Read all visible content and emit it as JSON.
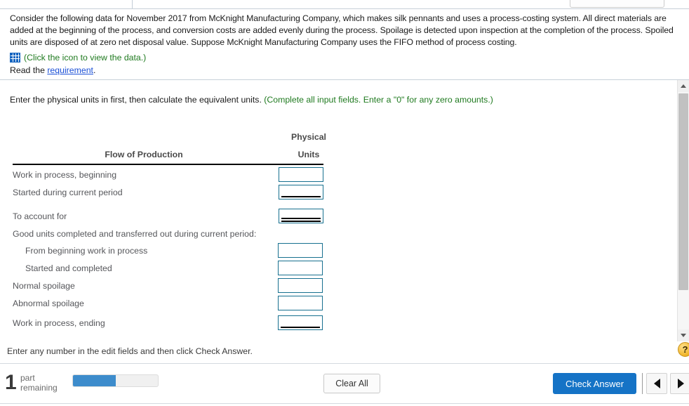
{
  "window": {
    "top_partial_button_label": ""
  },
  "problem": {
    "statement": "Consider the following data for November 2017 from McKnight Manufacturing Company, which makes silk pennants and uses a process-costing system. All direct materials are added at the beginning of the process, and conversion costs are added evenly during the process. Spoilage is detected upon inspection at the completion of the process. Spoiled units are disposed of at zero net disposal value. Suppose McKnight Manufacturing Company uses the FIFO method of process costing.",
    "data_link_text": "(Click the icon to view the data.)",
    "data_icon": "grid-table-icon",
    "read_prefix": "Read the ",
    "read_link": "requirement",
    "read_suffix": "."
  },
  "instruction": {
    "main": "Enter the physical units in first, then calculate the equivalent units. ",
    "hint": "(Complete all input fields. Enter a \"0\" for any zero amounts.)"
  },
  "table": {
    "header_col1": "Flow of Production",
    "header_col2_line1": "Physical",
    "header_col2_line2": "Units",
    "rows": [
      {
        "label": "Work in process, beginning",
        "indent": false,
        "input": true,
        "value": "",
        "rule": "none"
      },
      {
        "label": "Started during current period",
        "indent": false,
        "input": true,
        "value": "",
        "rule": "single"
      },
      {
        "label": "To account for",
        "indent": false,
        "input": true,
        "value": "",
        "rule": "double"
      },
      {
        "label": "Good units completed and transferred out during current period:",
        "indent": false,
        "input": false,
        "value": "",
        "rule": "none"
      },
      {
        "label": "From beginning work in process",
        "indent": true,
        "input": true,
        "value": "",
        "rule": "none"
      },
      {
        "label": "Started and completed",
        "indent": true,
        "input": true,
        "value": "",
        "rule": "none"
      },
      {
        "label": "Normal spoilage",
        "indent": false,
        "input": true,
        "value": "",
        "rule": "none"
      },
      {
        "label": "Abnormal spoilage",
        "indent": false,
        "input": true,
        "value": "",
        "rule": "none"
      },
      {
        "label": "Work in process, ending",
        "indent": false,
        "input": true,
        "value": "",
        "rule": "single"
      }
    ]
  },
  "footer": {
    "note": "Enter any number in the edit fields and then click Check Answer.",
    "help_icon_label": "?",
    "parts_count": "1",
    "parts_line1": "part",
    "parts_line2": "remaining",
    "progress_percent": 50,
    "clear_all_label": "Clear All",
    "check_answer_label": "Check Answer",
    "prev_icon": "triangle-left-icon",
    "next_icon": "triangle-right-icon"
  },
  "colors": {
    "accent_blue": "#1573c6",
    "progress_blue": "#3d8ccc",
    "input_border": "#17708f",
    "green_hint": "#1f7a1f",
    "link_blue": "#1a4fd6",
    "help_yellow": "#f0b429"
  }
}
